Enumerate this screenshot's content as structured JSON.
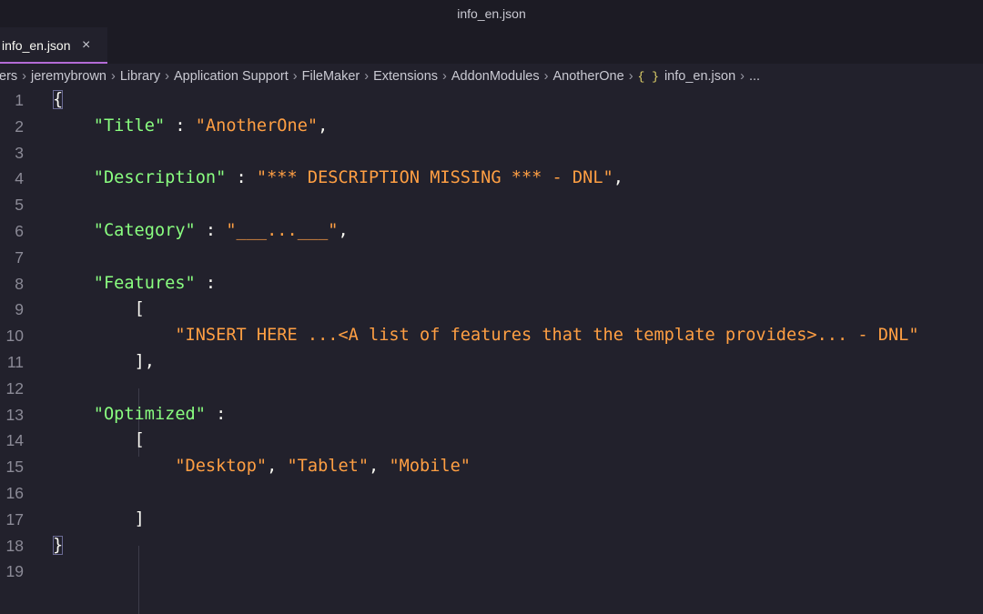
{
  "window": {
    "title": "info_en.json"
  },
  "tabs": [
    {
      "label": "info_en.json",
      "close_glyph": "×",
      "active": true
    }
  ],
  "breadcrumb": {
    "items": [
      "ers",
      "jeremybrown",
      "Library",
      "Application Support",
      "FileMaker",
      "Extensions",
      "AddonModules",
      "AnotherOne"
    ],
    "file_icon": "{ }",
    "file": "info_en.json",
    "trailing": "..."
  },
  "editor": {
    "line_numbers": [
      "1",
      "2",
      "3",
      "4",
      "5",
      "6",
      "7",
      "8",
      "9",
      "10",
      "11",
      "12",
      "13",
      "14",
      "15",
      "16",
      "17",
      "18",
      "19"
    ],
    "tokens": {
      "open_brace": "{",
      "close_brace": "}",
      "title_key": "\"Title\"",
      "title_value": "\"AnotherOne\"",
      "description_key": "\"Description\"",
      "description_value": "\"*** DESCRIPTION MISSING *** - DNL\"",
      "category_key": "\"Category\"",
      "category_value": "\"___...___\"",
      "features_key": "\"Features\"",
      "features_item": "\"INSERT HERE ...<A list of features that the template provides>... - DNL\"",
      "optimized_key": "\"Optimized\"",
      "optimized_desktop": "\"Desktop\"",
      "optimized_tablet": "\"Tablet\"",
      "optimized_mobile": "\"Mobile\"",
      "colon": " : ",
      "colon_trailing": " :",
      "comma": ",",
      "list_sep": ", ",
      "open_bracket": "[",
      "close_bracket": "]",
      "close_bracket_comma": "],"
    }
  },
  "colors": {
    "background": "#22212c",
    "key": "#8aff80",
    "string": "#ff9f43",
    "line_number": "#8b8a96",
    "tab_accent": "#b46bd6",
    "json_icon": "#e3d56a"
  }
}
